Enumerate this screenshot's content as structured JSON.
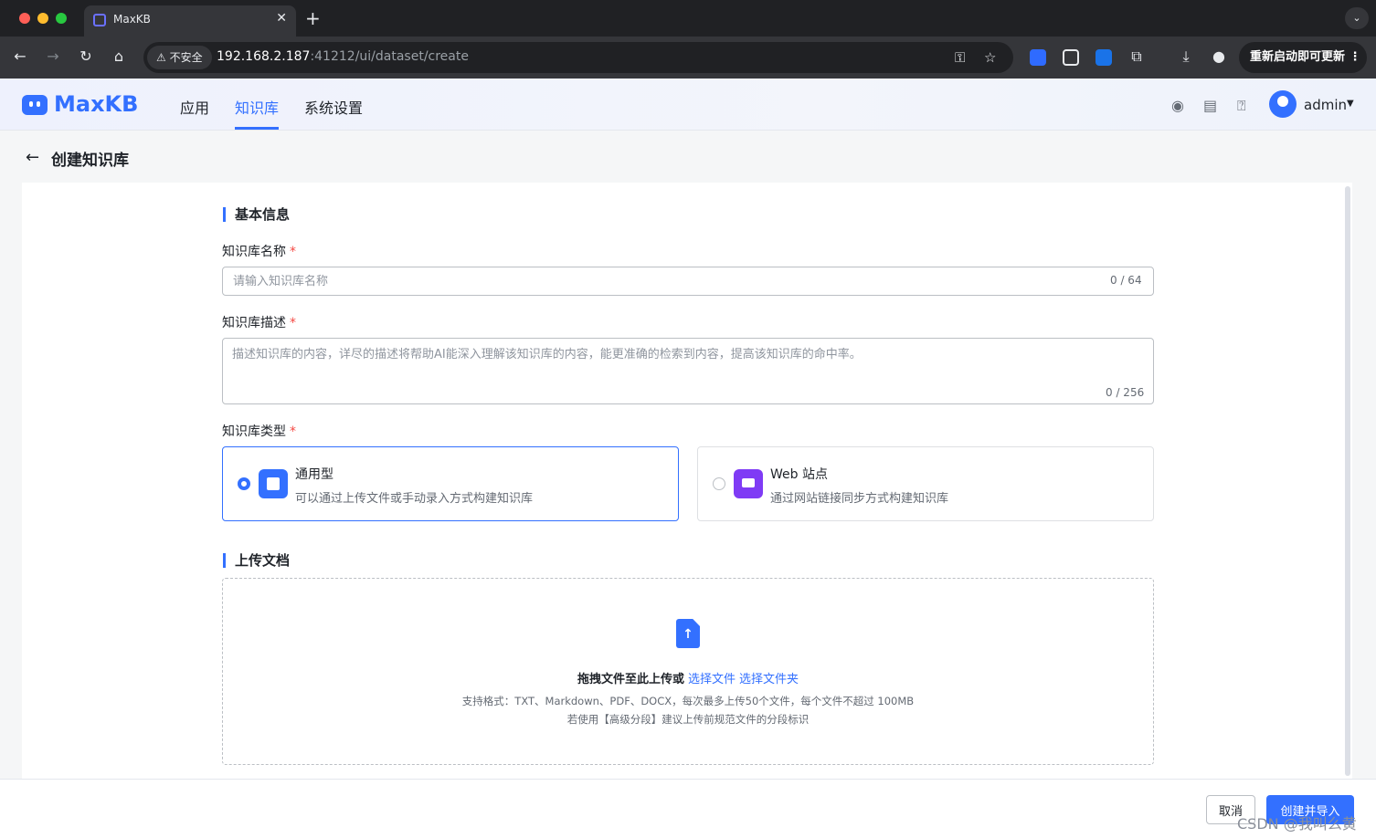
{
  "browser": {
    "tab_title": "MaxKB",
    "insecure_label": "不安全",
    "url_host": "192.168.2.187",
    "url_path": ":41212/ui/dataset/create",
    "restart_label": "重新启动即可更新",
    "icons": [
      "back-icon",
      "forward-icon",
      "reload-icon",
      "home-icon",
      "key-icon",
      "star-icon",
      "download-icon",
      "profile-icon",
      "more-icon"
    ]
  },
  "app": {
    "logo": "MaxKB",
    "menu": [
      {
        "label": "应用"
      },
      {
        "label": "知识库"
      },
      {
        "label": "系统设置"
      }
    ],
    "user": "admin",
    "accent": "#3370ff"
  },
  "page": {
    "title": "创建知识库",
    "basic_info": "基本信息",
    "name_label": "知识库名称",
    "name_placeholder": "请输入知识库名称",
    "name_count": "0 / 64",
    "desc_label": "知识库描述",
    "desc_placeholder": "描述知识库的内容，详尽的描述将帮助AI能深入理解该知识库的内容，能更准确的检索到内容，提高该知识库的命中率。",
    "desc_count": "0 / 256",
    "type_label": "知识库类型",
    "types": [
      {
        "name": "通用型",
        "desc": "可以通过上传文件或手动录入方式构建知识库",
        "selected": true
      },
      {
        "name": "Web 站点",
        "desc": "通过网站链接同步方式构建知识库",
        "selected": false
      }
    ],
    "upload_title": "上传文档",
    "upload_main": "拖拽文件至此上传或",
    "upload_select_file": "选择文件",
    "upload_select_folder": "选择文件夹",
    "upload_hint1": "支持格式：TXT、Markdown、PDF、DOCX，每次最多上传50个文件，每个文件不超过 100MB",
    "upload_hint2": "若使用【高级分段】建议上传前规范文件的分段标识"
  },
  "footer": {
    "cancel": "取消",
    "submit": "创建并导入"
  },
  "watermark": "CSDN @我叫么黄"
}
